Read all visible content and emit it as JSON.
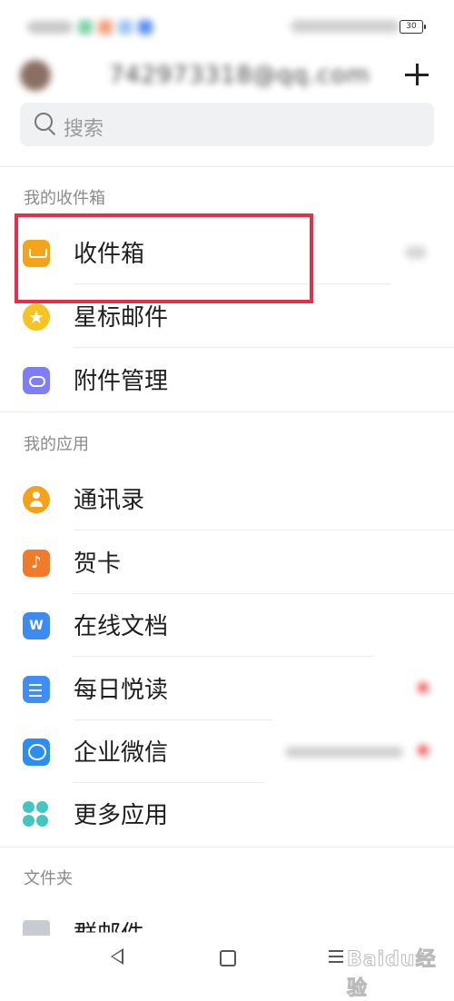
{
  "status_bar": {
    "battery": "30"
  },
  "account": {
    "email": "742973318@qq.com",
    "add_icon": "plus-icon"
  },
  "search": {
    "placeholder": "搜索"
  },
  "sections": {
    "mailboxes_title": "我的收件箱",
    "apps_title": "我的应用",
    "folders_title": "文件夹"
  },
  "mailboxes": [
    {
      "label": "收件箱",
      "icon": "inbox-icon"
    },
    {
      "label": "星标邮件",
      "icon": "star-icon"
    },
    {
      "label": "附件管理",
      "icon": "attachment-icon"
    }
  ],
  "apps": [
    {
      "label": "通讯录",
      "icon": "contacts-icon"
    },
    {
      "label": "贺卡",
      "icon": "greeting-card-icon"
    },
    {
      "label": "在线文档",
      "icon": "online-doc-icon",
      "icon_text": "W"
    },
    {
      "label": "每日悦读",
      "icon": "daily-reading-icon"
    },
    {
      "label": "企业微信",
      "icon": "wecom-icon"
    },
    {
      "label": "更多应用",
      "icon": "more-apps-icon"
    }
  ],
  "folders": [
    {
      "label": "群邮件",
      "icon": "folder-icon"
    }
  ],
  "highlight": {
    "color": "#e0304a"
  },
  "navigation": {
    "back": "back-icon",
    "home": "home-icon",
    "menu": "menu-icon"
  },
  "watermark": "Baidu经验"
}
